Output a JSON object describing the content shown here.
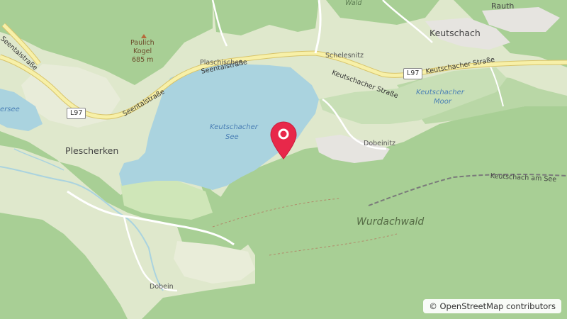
{
  "map": {
    "labels": {
      "wald": "Wald",
      "rauth": "Rauth",
      "keutschach": "Keutschach",
      "paulich_name1": "Paulich",
      "paulich_name2": "Kogel",
      "paulich_elev": "685 m",
      "plaschischen": "Plaschischen",
      "schelesnitz": "Schelesnitz",
      "seentalstrasse_1": "Seentalstraße",
      "seentalstrasse_2": "Seentalstraße",
      "seentalstrasse_3": "Seentalstraße",
      "keutschacher_strasse_1": "Keutschacher Straße",
      "keutschacher_strasse_2": "Keutschacher Straße",
      "l97_left": "L97",
      "l97_right": "L97",
      "keutschacher_moor_1": "Keutschacher",
      "keutschacher_moor_2": "Moor",
      "lake_1": "Keutschacher",
      "lake_2": "See",
      "nersee": "ersee",
      "plescherken": "Plescherken",
      "dobeinitz": "Dobeinitz",
      "keutschach_am_see": "Keutschach am See",
      "wurdachwald": "Wurdachwald",
      "dobein": "Dobein"
    },
    "attribution": "© OpenStreetMap contributors",
    "marker": {
      "icon": "location-pin-icon",
      "color": "#e8284a"
    },
    "colors": {
      "forest": "#a8cf95",
      "field": "#dfe8cc",
      "water": "#aad3df",
      "road_major": "#f7f0a8",
      "road_outline": "#d8c46a",
      "residential": "#e6e4e0"
    }
  }
}
